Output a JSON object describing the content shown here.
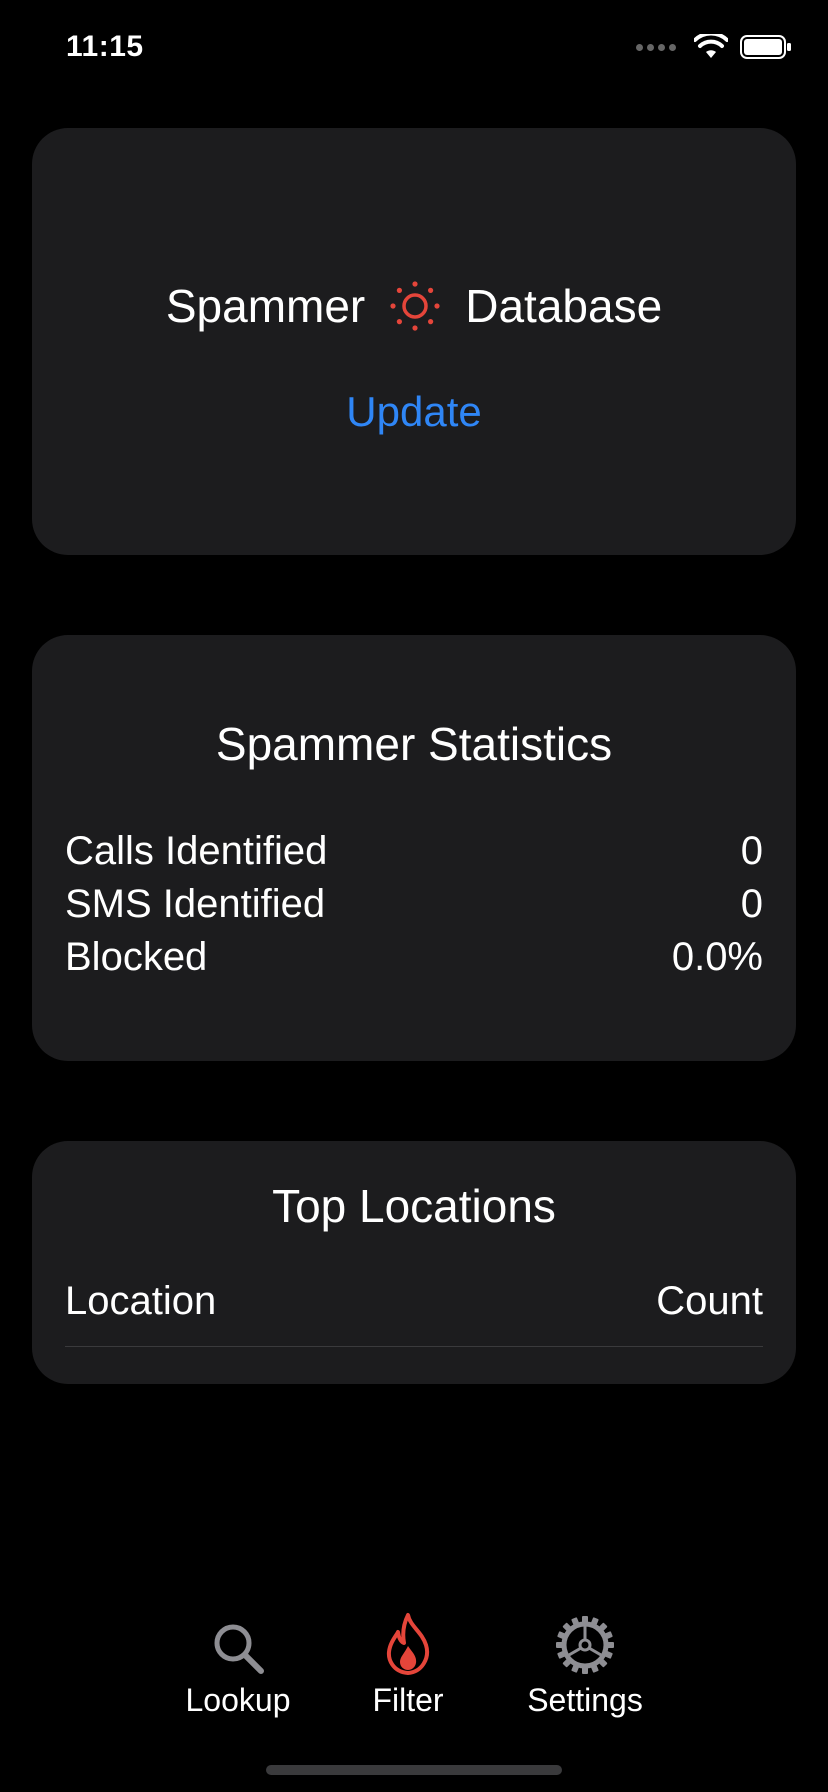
{
  "status_bar": {
    "time": "11:15",
    "icons": [
      "cellular-signal-icon",
      "wifi-icon",
      "battery-icon"
    ]
  },
  "database_card": {
    "title_left": "Spammer",
    "title_icon": "sun-icon",
    "title_right": "Database",
    "update_label": "Update"
  },
  "stats_card": {
    "title": "Spammer Statistics",
    "rows": [
      {
        "label": "Calls Identified",
        "value": "0"
      },
      {
        "label": "SMS Identified",
        "value": "0"
      },
      {
        "label": "Blocked",
        "value": "0.0%"
      }
    ]
  },
  "locations_card": {
    "title": "Top Locations",
    "header_location": "Location",
    "header_count": "Count"
  },
  "tab_bar": {
    "tabs": [
      {
        "label": "Lookup",
        "icon": "magnifying-glass-icon",
        "selected": false
      },
      {
        "label": "Filter",
        "icon": "flame-icon",
        "selected": true
      },
      {
        "label": "Settings",
        "icon": "gear-icon",
        "selected": false
      }
    ]
  },
  "colors": {
    "background": "#000000",
    "card": "#1c1c1e",
    "accent_blue": "#2f86f6",
    "accent_red": "#e5453a",
    "inactive_icon": "#8e8e93"
  }
}
